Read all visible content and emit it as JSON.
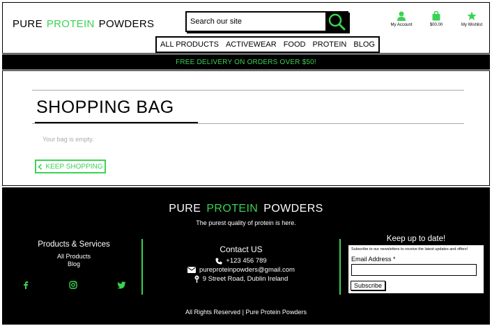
{
  "header": {
    "logo": {
      "word1": "PURE",
      "word2": "PROTEIN",
      "word3": "POWDERS"
    },
    "search": {
      "placeholder": "Search our site"
    },
    "account_label": "My Account",
    "bag_total": "$00.00",
    "wishlist_label": "My Wishlist",
    "nav": [
      "ALL PRODUCTS",
      "ACTIVEWEAR",
      "FOOD",
      "PROTEIN",
      "BLOG"
    ]
  },
  "banner": {
    "text": "FREE DELIVERY ON ORDERS OVER $50!"
  },
  "main": {
    "title": "SHOPPING BAG",
    "empty_message": "Your bag is empty.",
    "keep_shopping": "KEEP SHOPPING"
  },
  "footer": {
    "brand": {
      "word1": "PURE",
      "word2": "PROTEIN",
      "word3": "POWDERS"
    },
    "tagline": "The purest quality of protein is here.",
    "products": {
      "heading": "Products & Services",
      "links": [
        "All Products",
        "Blog"
      ]
    },
    "social": [
      "facebook-icon",
      "instagram-icon",
      "twitter-icon"
    ],
    "contact": {
      "heading": "Contact US",
      "phone": "+123 456 789",
      "email": "pureproteinpowders@gmail.com",
      "address": "9 Street Road, Dublin Ireland"
    },
    "newsletter": {
      "heading": "Keep up to date!",
      "text": "Subscribe to our newsletters to receive the latest updates and offers!",
      "email_label": "Email Address *",
      "button": "Subscribe"
    },
    "copyright": "All Rights Reserved | Pure Protein Powders"
  },
  "colors": {
    "accent": "#39d353",
    "dark": "#000000",
    "muted": "#aaaaaa"
  }
}
